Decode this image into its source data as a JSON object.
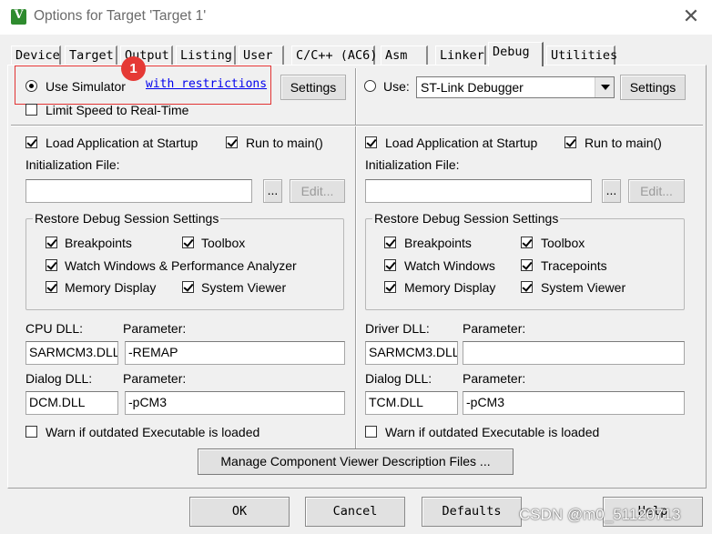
{
  "window": {
    "title": "Options for Target 'Target 1'",
    "close_glyph": "✕",
    "icon_glyph": "V"
  },
  "tabs": [
    {
      "label": "Device"
    },
    {
      "label": "Target"
    },
    {
      "label": "Output"
    },
    {
      "label": "Listing"
    },
    {
      "label": "User"
    },
    {
      "label": "C/C++ (AC6)"
    },
    {
      "label": "Asm"
    },
    {
      "label": "Linker"
    },
    {
      "label": "Debug",
      "active": true
    },
    {
      "label": "Utilities"
    }
  ],
  "annotation": {
    "badge": "1"
  },
  "left": {
    "use_simulator": {
      "label": "Use Simulator",
      "selected": true
    },
    "restrictions_link": "with restrictions",
    "settings_label": "Settings",
    "limit_speed": {
      "label": "Limit Speed to Real-Time",
      "checked": false
    },
    "load_app": {
      "label": "Load Application at Startup",
      "checked": true
    },
    "run_to_main": {
      "label": "Run to main()",
      "checked": true
    },
    "init_file_label": "Initialization File:",
    "init_file_value": "",
    "browse_label": "...",
    "edit_label": "Edit...",
    "restore_group": {
      "title": "Restore Debug Session Settings",
      "breakpoints": "Breakpoints",
      "toolbox": "Toolbox",
      "watch": "Watch Windows & Performance Analyzer",
      "memory": "Memory Display",
      "system_viewer": "System Viewer"
    },
    "cpu_dll_label": "CPU DLL:",
    "cpu_dll_value": "SARMCM3.DLL",
    "parameter_label": "Parameter:",
    "cpu_param_value": "-REMAP",
    "dialog_dll_label": "Dialog DLL:",
    "dialog_dll_value": "DCM.DLL",
    "dialog_param_value": "-pCM3",
    "warn": {
      "label": "Warn if outdated Executable is loaded",
      "checked": false
    }
  },
  "right": {
    "use": {
      "label": "Use:",
      "selected": false
    },
    "debugger_value": "ST-Link Debugger",
    "settings_label": "Settings",
    "load_app": {
      "label": "Load Application at Startup",
      "checked": true
    },
    "run_to_main": {
      "label": "Run to main()",
      "checked": true
    },
    "init_file_label": "Initialization File:",
    "init_file_value": "",
    "browse_label": "...",
    "edit_label": "Edit...",
    "restore_group": {
      "title": "Restore Debug Session Settings",
      "breakpoints": "Breakpoints",
      "toolbox": "Toolbox",
      "watch": "Watch Windows",
      "tracepoints": "Tracepoints",
      "memory": "Memory Display",
      "system_viewer": "System Viewer"
    },
    "driver_dll_label": "Driver DLL:",
    "driver_dll_value": "SARMCM3.DLL",
    "parameter_label": "Parameter:",
    "driver_param_value": "",
    "dialog_dll_label": "Dialog DLL:",
    "dialog_dll_value": "TCM.DLL",
    "dialog_param_value": "-pCM3",
    "warn": {
      "label": "Warn if outdated Executable is loaded",
      "checked": false
    }
  },
  "manage_button": "Manage Component Viewer Description Files ...",
  "footer": {
    "ok": "OK",
    "cancel": "Cancel",
    "defaults": "Defaults",
    "help": "Help"
  },
  "watermark": "CSDN @m0_51120713"
}
